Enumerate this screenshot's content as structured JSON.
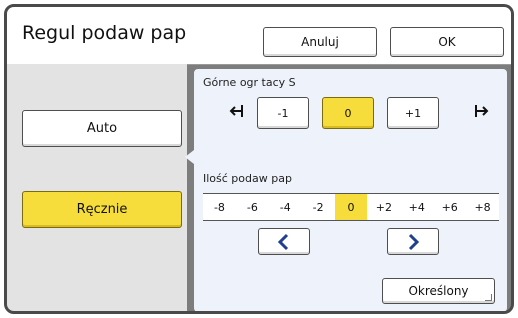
{
  "header": {
    "title": "Regul podaw pap",
    "cancel_label": "Anuluj",
    "ok_label": "OK"
  },
  "mode": {
    "auto_label": "Auto",
    "manual_label": "Ręcznie",
    "selected": "manual"
  },
  "tray_limit": {
    "label": "Górne ogr tacy S",
    "options": [
      "-1",
      "0",
      "+1"
    ],
    "selected": "0",
    "left_icon": "tray-decrease-icon",
    "right_icon": "tray-increase-icon"
  },
  "feed_amount": {
    "label": "Ilość podaw pap",
    "scale": [
      "-8",
      "-6",
      "-4",
      "-2",
      "0",
      "+2",
      "+4",
      "+6",
      "+8"
    ],
    "selected": "0",
    "left_arrow_icon": "chevron-left-icon",
    "right_arrow_icon": "chevron-right-icon"
  },
  "specified_label": "Określony",
  "colors": {
    "accent": "#f6dd3b",
    "frame": "#7d7d7d",
    "panel": "#eef3fb",
    "button_border": "#4e4e4e"
  }
}
